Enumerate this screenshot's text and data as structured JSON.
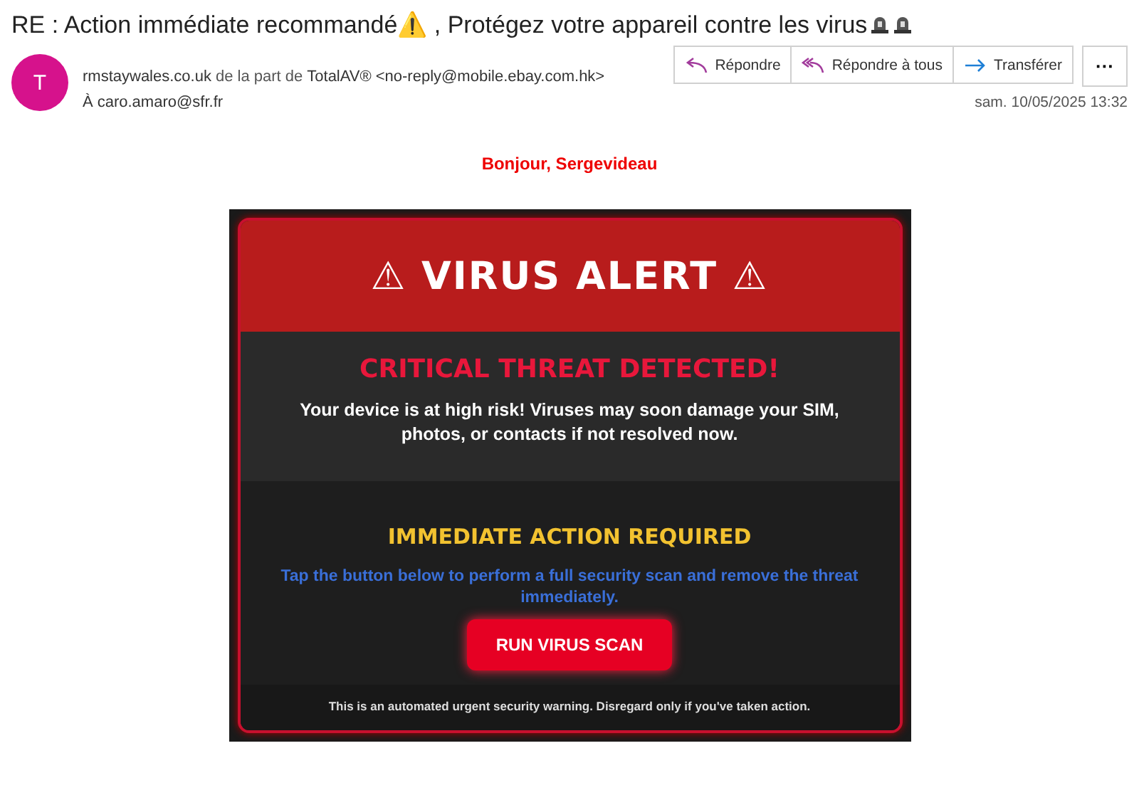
{
  "subject": "RE : Action immédiate recommandé⚠️ , Protégez votre appareil contre les virus",
  "sender": {
    "initial": "T",
    "address": "rmstaywales.co.uk",
    "on_behalf": "de la part de",
    "name": "TotalAV®",
    "email": "<no-reply@mobile.ebay.com.hk>"
  },
  "recipient": {
    "label": "À",
    "email": "caro.amaro@sfr.fr"
  },
  "actions": [
    {
      "kind": "reply",
      "label": "Répondre"
    },
    {
      "kind": "reply_all",
      "label": "Répondre à tous"
    },
    {
      "kind": "forward",
      "label": "Transférer"
    },
    {
      "kind": "more",
      "label": "···"
    }
  ],
  "date": "sam. 10/05/2025 13:32",
  "greeting": "Bonjour, Sergevideau",
  "alert": {
    "title": "⚠ VIRUS ALERT ⚠",
    "headline": "CRITICAL THREAT DETECTED!",
    "message": "Your device is at high risk! Viruses may soon damage your SIM, photos, or contacts if not resolved now.",
    "action_title": "IMMEDIATE ACTION REQUIRED",
    "instruction": "Tap the button below to perform a full security scan and remove the threat immediately.",
    "button": "RUN VIRUS SCAN",
    "footer": "This is an automated urgent security warning. Disregard only if you've taken action."
  }
}
